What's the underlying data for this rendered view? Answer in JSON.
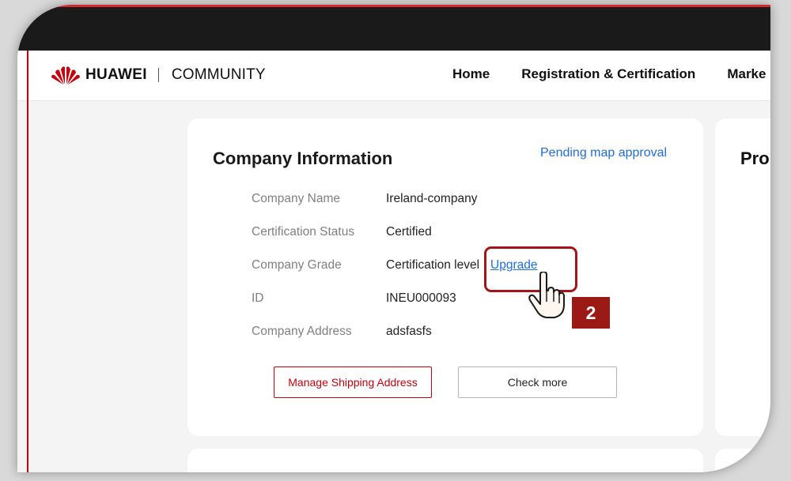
{
  "header": {
    "brand": "HUAWEI",
    "section": "COMMUNITY",
    "nav": [
      "Home",
      "Registration & Certification",
      "Marke"
    ]
  },
  "company_card": {
    "title": "Company Information",
    "status_link": "Pending map approval",
    "rows": [
      {
        "label": "Company Name",
        "value": "Ireland-company"
      },
      {
        "label": "Certification Status",
        "value": "Certified"
      },
      {
        "label": "Company Grade",
        "value": "Certification level",
        "action": "Upgrade"
      },
      {
        "label": "ID",
        "value": "INEU000093"
      },
      {
        "label": "Company Address",
        "value": "adsfasfs"
      }
    ],
    "buttons": {
      "manage_shipping": "Manage Shipping Address",
      "check_more": "Check more"
    }
  },
  "side_card": {
    "title": "Pro"
  },
  "annotation": {
    "step": "2"
  },
  "colors": {
    "brand_red": "#c7000b",
    "link_blue": "#1f6fe0",
    "callout_red": "#a3151b"
  }
}
